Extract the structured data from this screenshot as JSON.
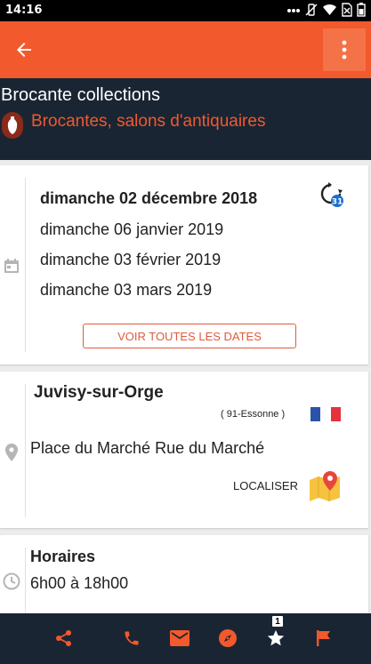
{
  "status_bar": {
    "time": "14:16"
  },
  "app": {
    "title": "Brocante collections",
    "category": "Brocantes, salons d'antiquaires",
    "colors": {
      "accent": "#f2592c",
      "dark": "#1a2533"
    }
  },
  "dates": {
    "items": [
      "dimanche 02 décembre 2018",
      "dimanche 06 janvier 2019",
      "dimanche 03 février 2019",
      "dimanche 03 mars 2019"
    ],
    "recurrence_number": "31",
    "see_all_label": "VOIR TOUTES LES DATES"
  },
  "location": {
    "city": "Juvisy-sur-Orge",
    "department": "( 91-Essonne )",
    "address": "Place du Marché Rue du Marché",
    "localiser_label": "LOCALISER"
  },
  "hours": {
    "title": "Horaires",
    "value": "6h00 à 18h00"
  },
  "bottom_bar": {
    "icons": [
      "share-icon",
      "phone-icon",
      "mail-icon",
      "compass-icon",
      "star-icon",
      "flag-icon"
    ],
    "favorite_badge": "1"
  }
}
